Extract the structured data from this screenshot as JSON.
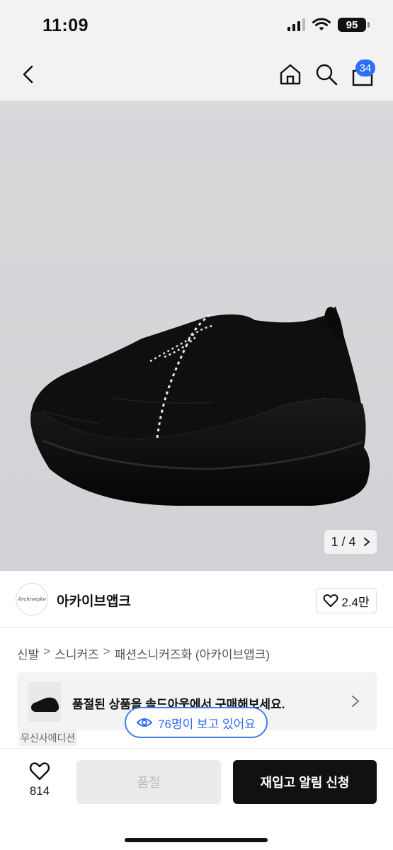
{
  "status_bar": {
    "time": "11:09",
    "battery": "95"
  },
  "nav": {
    "cart_count": "34"
  },
  "gallery": {
    "counter": "1 / 4"
  },
  "brand": {
    "logo_text": "Archivepke",
    "name": "아카이브앱크",
    "likes": "2.4만"
  },
  "breadcrumb": {
    "items": [
      "신발",
      "스니커즈",
      "패션스니커즈화 (아카이브앱크)"
    ]
  },
  "soldout_banner": {
    "text": "품절된 상품을 솔드아웃에서 구매해보세요."
  },
  "viewers": {
    "text": "76명이 보고 있어요"
  },
  "partial_tag": "무신사에디션",
  "bottom_bar": {
    "wish_count": "814",
    "soldout_label": "품절",
    "restock_label": "재입고 알림 신청"
  },
  "colors": {
    "accent": "#2f6df6",
    "primary_button": "#111111"
  }
}
